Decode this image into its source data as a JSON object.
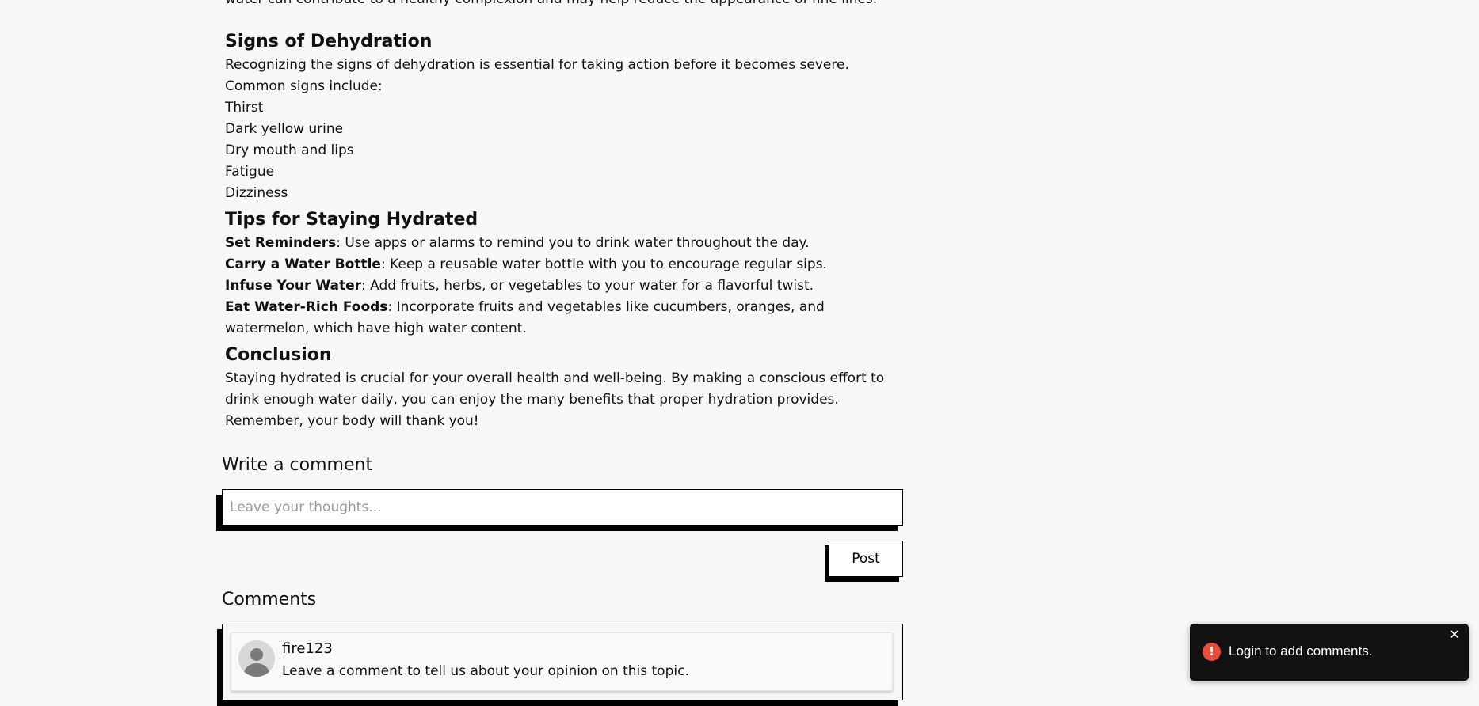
{
  "article": {
    "partial_intro": "water can contribute to a healthy complexion and may help reduce the appearance of fine lines.",
    "dehydration": {
      "heading": "Signs of Dehydration",
      "intro": "Recognizing the signs of dehydration is essential for taking action before it becomes severe. Common signs include:",
      "signs": [
        "Thirst",
        "Dark yellow urine",
        "Dry mouth and lips",
        "Fatigue",
        "Dizziness"
      ]
    },
    "tips": {
      "heading": "Tips for Staying Hydrated",
      "items": [
        {
          "name": "Set Reminders",
          "text": ": Use apps or alarms to remind you to drink water throughout the day."
        },
        {
          "name": "Carry a Water Bottle",
          "text": ": Keep a reusable water bottle with you to encourage regular sips."
        },
        {
          "name": "Infuse Your Water",
          "text": ": Add fruits, herbs, or vegetables to your water for a flavorful twist."
        },
        {
          "name": "Eat Water-Rich Foods",
          "text": ": Incorporate fruits and vegetables like cucumbers, oranges, and watermelon, which have high water content."
        }
      ]
    },
    "conclusion": {
      "heading": "Conclusion",
      "text": "Staying hydrated is crucial for your overall health and well-being. By making a conscious effort to drink enough water daily, you can enjoy the many benefits that proper hydration provides. Remember, your body will thank you!"
    }
  },
  "comment_form": {
    "title": "Write a comment",
    "placeholder": "Leave your thoughts...",
    "value": "",
    "post_label": "Post"
  },
  "comments": {
    "title": "Comments",
    "items": [
      {
        "user": "fire123",
        "text": "Leave a comment to tell us about your opinion on this topic."
      }
    ]
  },
  "toast": {
    "icon": "error-icon",
    "icon_glyph": "!",
    "message": "Login to add comments.",
    "close_glyph": "✕",
    "accent_color": "#e74c3c"
  }
}
